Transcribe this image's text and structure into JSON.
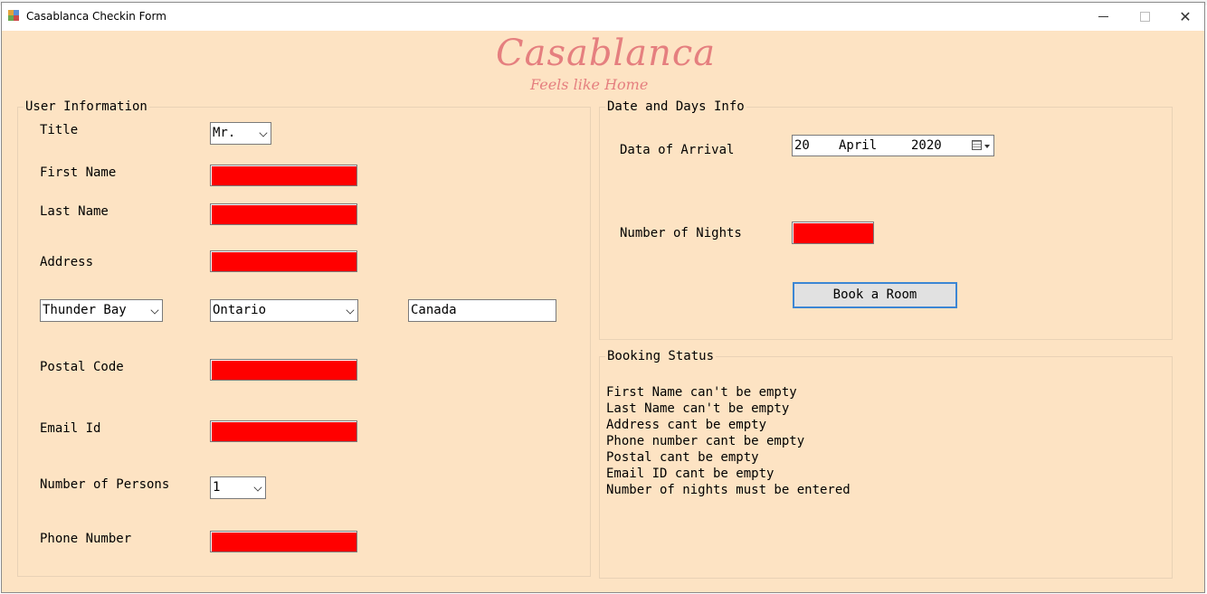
{
  "window": {
    "title": "Casablanca Checkin Form",
    "controls": {
      "minimize": "—",
      "maximize": "☐",
      "close": "✕"
    }
  },
  "brand": {
    "title": "Casablanca",
    "tagline": "Feels like Home",
    "color": "#e57f7f"
  },
  "user_info": {
    "group_label": "User Information",
    "title_label": "Title",
    "title_value": "Mr.",
    "first_name_label": "First Name",
    "last_name_label": "Last Name",
    "address_label": "Address",
    "city_value": "Thunder Bay",
    "province_value": "Ontario",
    "country_value": "Canada",
    "postal_label": "Postal Code",
    "email_label": "Email Id",
    "persons_label": "Number of Persons",
    "persons_value": "1",
    "phone_label": "Phone Number"
  },
  "date_info": {
    "group_label": "Date and Days Info",
    "arrival_label": "Data of Arrival",
    "arrival_day": "20",
    "arrival_month": "April",
    "arrival_year": "2020",
    "nights_label": "Number of Nights",
    "book_button": "Book a Room"
  },
  "booking_status": {
    "group_label": "Booking Status",
    "messages": [
      "First Name can't be empty",
      "Last Name can't be empty",
      "Address cant be empty",
      "Phone number cant be empty",
      "Postal cant be empty",
      "Email ID cant be empty",
      "Number of nights must be entered"
    ]
  },
  "colors": {
    "form_background": "#fde3c3",
    "error_field": "#ff0000",
    "button_focus_border": "#3b86d4"
  }
}
